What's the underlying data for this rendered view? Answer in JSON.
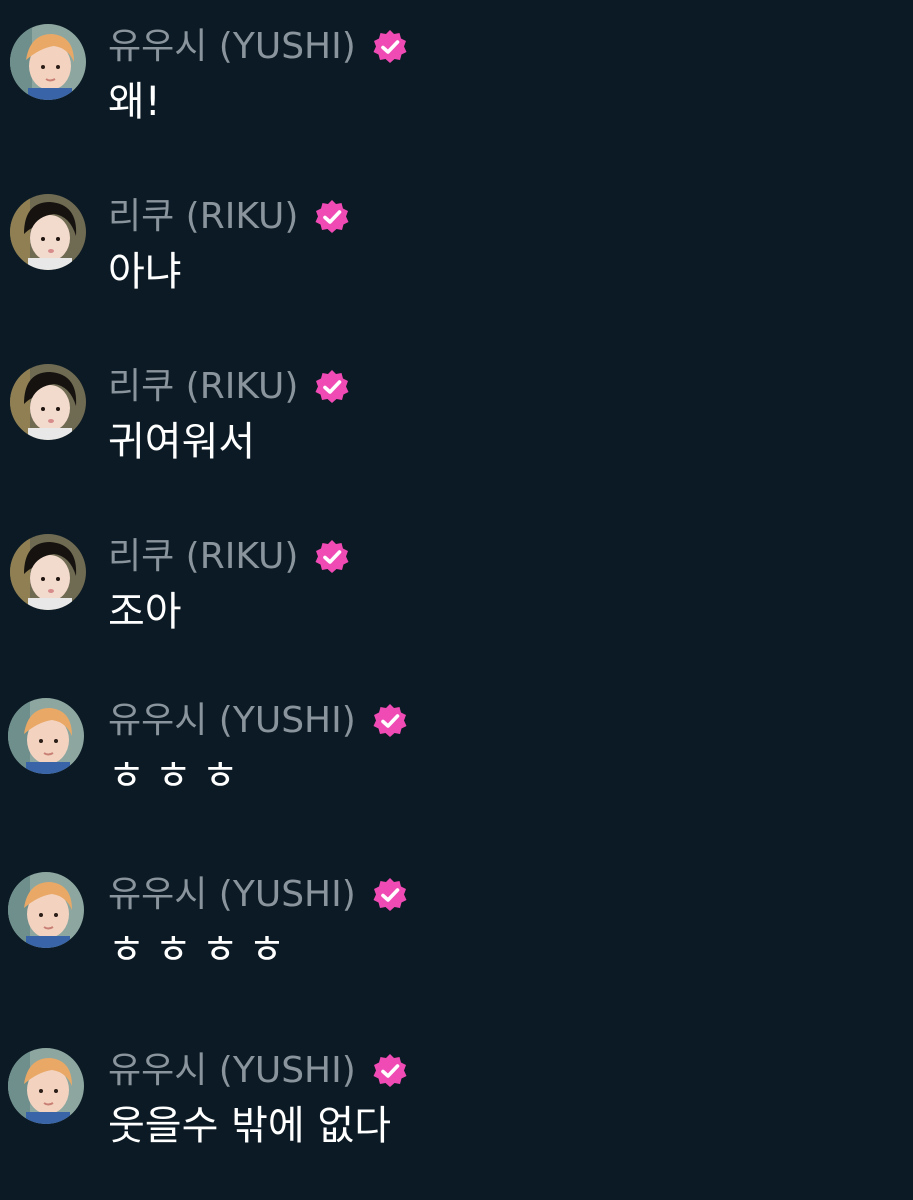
{
  "colors": {
    "background": "#0b1a24",
    "name_text": "#8a949c",
    "message_text": "#ffffff",
    "verified_badge": "#f04bb5"
  },
  "messages": [
    {
      "author": "유우시 (YUSHI)",
      "verified": true,
      "avatar_icon": "yushi-avatar",
      "text": "왜!"
    },
    {
      "author": "리쿠 (RIKU)",
      "verified": true,
      "avatar_icon": "riku-avatar",
      "text": "아냐"
    },
    {
      "author": "리쿠 (RIKU)",
      "verified": true,
      "avatar_icon": "riku-avatar",
      "text": "귀여워서"
    },
    {
      "author": "리쿠 (RIKU)",
      "verified": true,
      "avatar_icon": "riku-avatar",
      "text": "조아"
    },
    {
      "author": "유우시 (YUSHI)",
      "verified": true,
      "avatar_icon": "yushi-avatar",
      "text": "ㅎㅎㅎ"
    },
    {
      "author": "유우시 (YUSHI)",
      "verified": true,
      "avatar_icon": "yushi-avatar",
      "text": "ㅎㅎㅎㅎ"
    },
    {
      "author": "유우시 (YUSHI)",
      "verified": true,
      "avatar_icon": "yushi-avatar",
      "text": "웃을수 밖에 없다"
    }
  ]
}
